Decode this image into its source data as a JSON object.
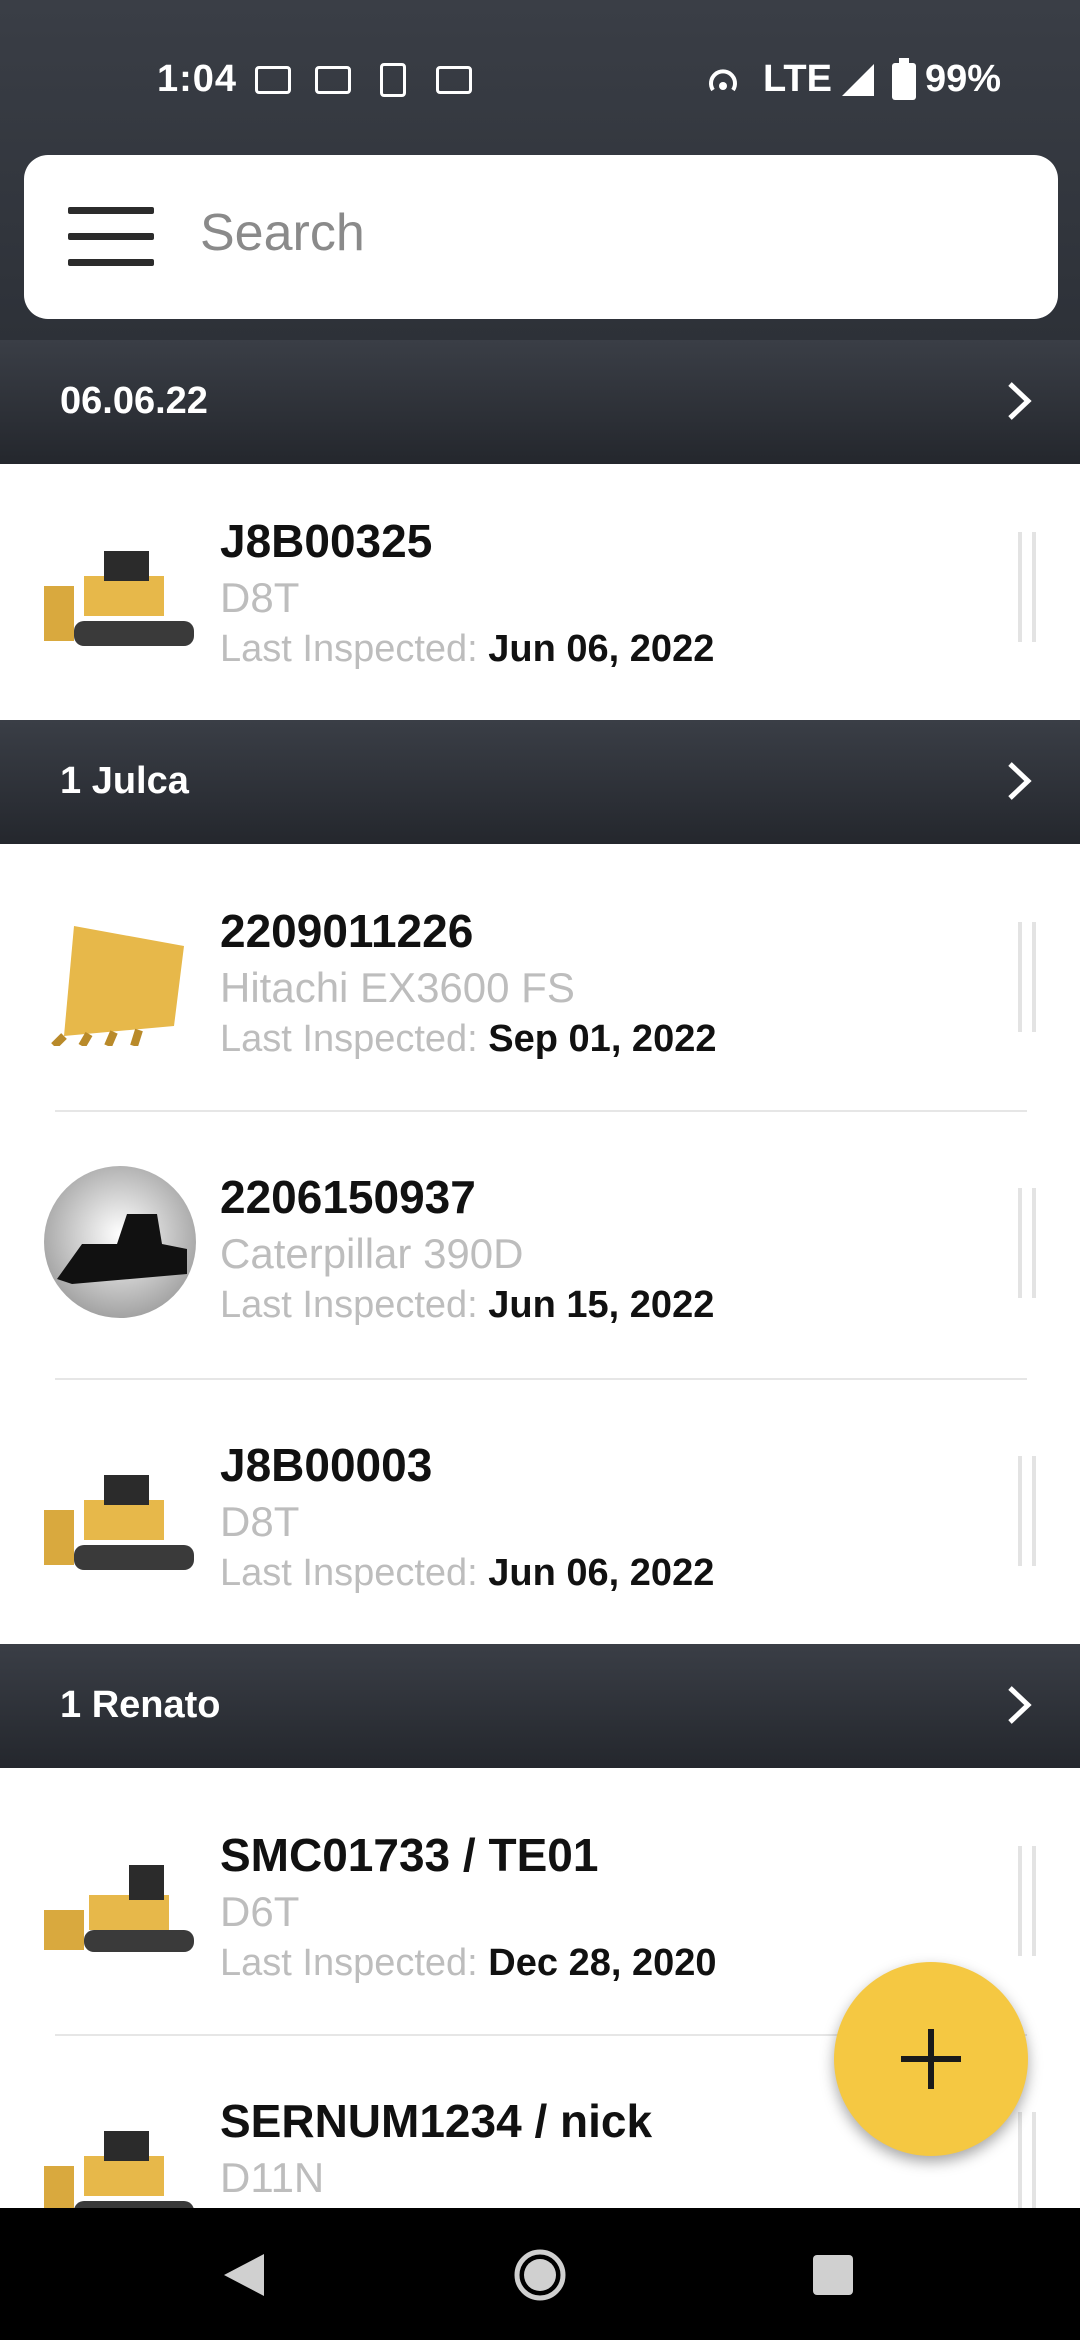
{
  "status_bar": {
    "time": "1:04",
    "network": "LTE",
    "battery": "99%"
  },
  "search": {
    "placeholder": "Search"
  },
  "sections": [
    {
      "title": "06.06.22",
      "items": [
        {
          "serial": "J8B00325",
          "model": "D8T",
          "inspected_label": "Last Inspected:",
          "inspected_date": "Jun 06, 2022",
          "icon": "dozer-icon"
        }
      ]
    },
    {
      "title": "1 Julca",
      "items": [
        {
          "serial": "2209011226",
          "model": "Hitachi EX3600 FS",
          "inspected_label": "Last Inspected:",
          "inspected_date": "Sep 01, 2022",
          "icon": "bucket-icon"
        },
        {
          "serial": "2206150937",
          "model": "Caterpillar 390D",
          "inspected_label": "Last Inspected:",
          "inspected_date": "Jun 15, 2022",
          "icon": "dozer-silhouette-icon"
        },
        {
          "serial": "J8B00003",
          "model": "D8T",
          "inspected_label": "Last Inspected:",
          "inspected_date": "Jun 06, 2022",
          "icon": "dozer-icon"
        }
      ]
    },
    {
      "title": "1 Renato",
      "items": [
        {
          "serial": "SMC01733 / TE01",
          "model": "D6T",
          "inspected_label": "Last Inspected:",
          "inspected_date": "Dec 28, 2020",
          "icon": "dozer-icon"
        },
        {
          "serial": "SERNUM1234 / nick",
          "model": "D11N",
          "inspected_label": "",
          "inspected_date": "",
          "icon": "dozer-icon"
        }
      ]
    }
  ],
  "colors": {
    "header_dark": "#2d3138",
    "accent_yellow": "#f5c842",
    "machine_yellow": "#e7b84a"
  }
}
